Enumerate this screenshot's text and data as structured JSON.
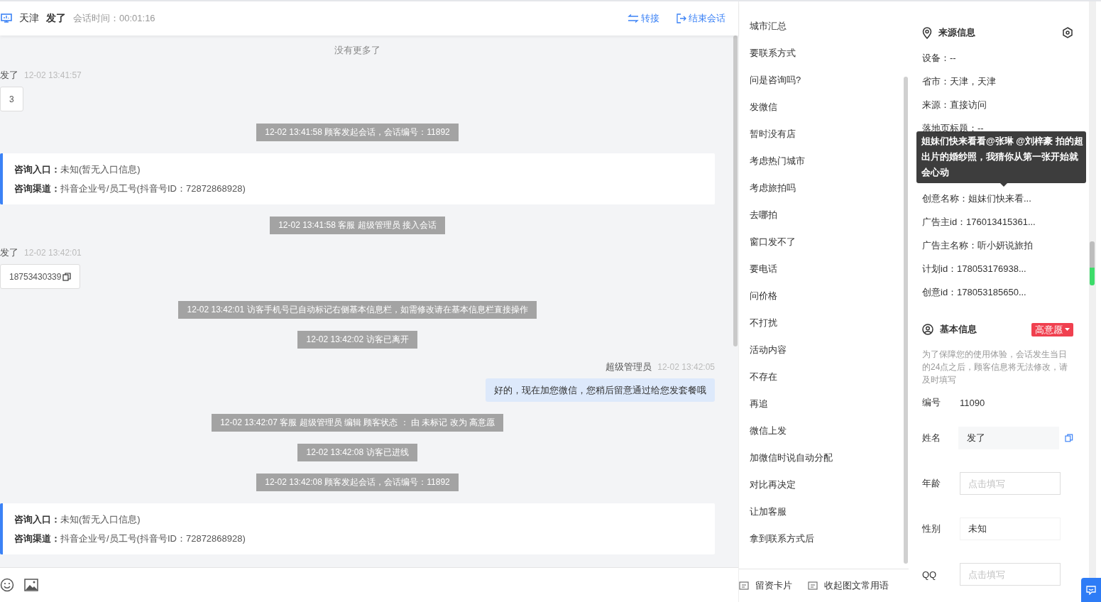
{
  "header": {
    "city": "天津",
    "visitor": "发了",
    "duration": "会话时间：00:01:16",
    "actions": [
      {
        "kind": "transfer",
        "label": "转接"
      },
      {
        "kind": "end",
        "label": "结束会话"
      }
    ]
  },
  "messages": [
    {
      "kind": "notice",
      "text": "没有更多了"
    },
    {
      "kind": "visitor",
      "name": "发了",
      "time": "12-02 13:41:57",
      "text": "3",
      "copyable": false
    },
    {
      "kind": "system",
      "text": "12-02 13:41:58 顾客发起会话，会话编号：11892"
    },
    {
      "kind": "source",
      "entries": [
        {
          "label": "咨询入口：",
          "value": "未知(暂无入口信息)"
        },
        {
          "label": "咨询渠道：",
          "value": "抖音企业号/员工号(抖音号ID：72872868928)"
        }
      ]
    },
    {
      "kind": "system",
      "text": "12-02 13:41:58 客服 超级管理员 接入会话"
    },
    {
      "kind": "visitor",
      "name": "发了",
      "time": "12-02 13:42:01",
      "text": "18753430339",
      "copyable": true
    },
    {
      "kind": "system",
      "text": "12-02 13:42:01 访客手机号已自动标记右侧基本信息栏，如需修改请在基本信息栏直接操作"
    },
    {
      "kind": "system",
      "text": "12-02 13:42:02 访客已离开"
    },
    {
      "kind": "agent",
      "name": "超级管理员",
      "time": "12-02 13:42:05",
      "text": "好的，现在加您微信，您稍后留意通过给您发套餐哦"
    },
    {
      "kind": "system",
      "text": "12-02 13:42:07 客服 超级管理员 编辑 顾客状态 ： 由 未标记 改为 高意愿"
    },
    {
      "kind": "system",
      "text": "12-02 13:42:08 访客已进线"
    },
    {
      "kind": "system",
      "text": "12-02 13:42:08 顾客发起会话，会话编号：11892"
    },
    {
      "kind": "source",
      "entries": [
        {
          "label": "咨询入口：",
          "value": "未知(暂无入口信息)"
        },
        {
          "label": "咨询渠道：",
          "value": "抖音企业号/员工号(抖音号ID：72872868928)"
        }
      ]
    }
  ],
  "input_toolbar": [
    {
      "kind": "emoji"
    },
    {
      "kind": "image"
    }
  ],
  "phrases": [
    "城市汇总",
    "要联系方式",
    "问是咨询吗?",
    "发微信",
    "暂时没有店",
    "考虑热门城市",
    "考虑旅拍吗",
    "去哪拍",
    "窗口发不了",
    "要电话",
    "问价格",
    "不打扰",
    "活动内容",
    "不存在",
    "再追",
    "微信上发",
    "加微信时说自动分配",
    "对比再决定",
    "让加客服",
    "拿到联系方式后"
  ],
  "phrase_footer": [
    "留资卡片",
    "收起图文常用语"
  ],
  "source_info": {
    "title": "来源信息",
    "rows": [
      {
        "kind": "row",
        "text": "设备：--"
      },
      {
        "kind": "row",
        "text": "省市：天津，天津"
      },
      {
        "kind": "row",
        "text": "来源：直接访问"
      },
      {
        "kind": "row",
        "text": "落地页标题：--"
      },
      {
        "kind": "covered"
      },
      {
        "kind": "covered"
      },
      {
        "kind": "row",
        "text": "创意名称：姐妹们快来看..."
      },
      {
        "kind": "row",
        "text": "广告主id：176013415361..."
      },
      {
        "kind": "row",
        "text": "广告主名称：听小妍说旅拍"
      },
      {
        "kind": "row",
        "text": "计划id：178053176938..."
      },
      {
        "kind": "row",
        "text": "创意id：178053185650..."
      }
    ],
    "tooltip": "姐妹们快来看看@张琳 @刘梓豪 拍的超出片的婚纱照，我猜你从第一张开始就会心动"
  },
  "basic_info": {
    "title": "基本信息",
    "status": "高意愿",
    "note": "为了保障您的使用体验，会话发生当日的24点之后，顾客信息将无法修改，请及时填写",
    "fields": [
      {
        "kind": "text",
        "label": "编号",
        "value": "11090"
      },
      {
        "kind": "readonly",
        "label": "姓名",
        "value": "发了"
      },
      {
        "kind": "input",
        "label": "年龄",
        "placeholder": "点击填写"
      },
      {
        "kind": "select",
        "label": "性别",
        "value": "未知"
      },
      {
        "kind": "input",
        "label": "QQ",
        "placeholder": "点击填写"
      }
    ]
  }
}
